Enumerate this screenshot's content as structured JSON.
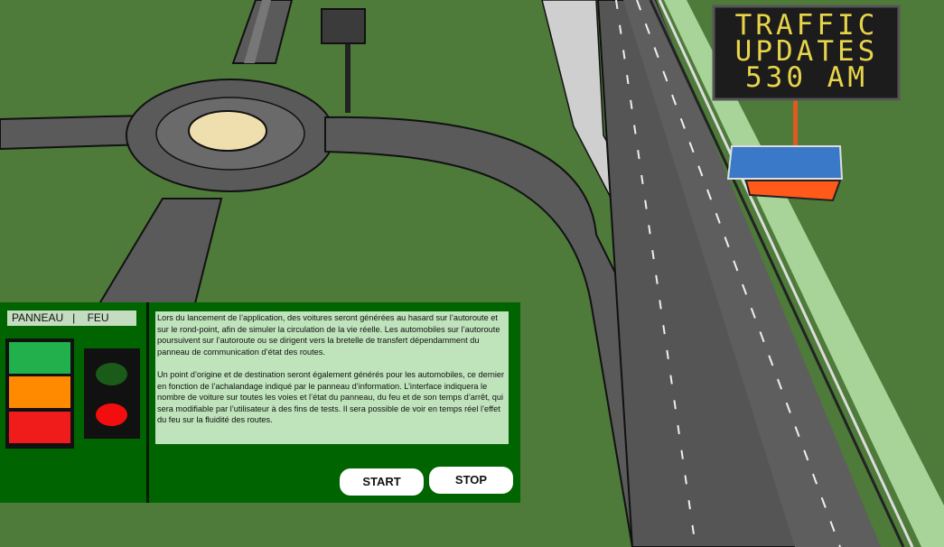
{
  "scene": {
    "traffic_sign": {
      "lines": [
        "TRAFFIC",
        "UPDATES",
        "530 AM"
      ],
      "text_color": "#e8d44a"
    }
  },
  "panel": {
    "header": "PANNEAU   |    FEU",
    "sign_colors": [
      "#21b04c",
      "#ff8a00",
      "#f01c1c"
    ],
    "traffic_light": {
      "green_state": "off",
      "red_state": "on"
    },
    "info": {
      "paragraph1": "Lors du lancement de l’application, des voitures seront générées au hasard sur l’autoroute et sur le rond-point, afin de simuler la circulation de la vie réelle. Les automobiles sur l’autoroute poursuivent sur l’autoroute ou se dirigent vers la bretelle de transfert dépendamment du panneau de communication d’état des routes.",
      "paragraph2": "Un point d’origine et de destination seront également générés pour les automobiles, ce dernier en fonction de l’achalandage indiqué par le panneau d’information. L’interface indiquera le nombre de voiture sur toutes les voies et l’état du panneau, du feu et de son temps d’arrêt, qui sera modifiable par l’utilisateur à des fins de tests. Il sera possible de voir en temps réel l’effet du feu sur la fluidité des routes."
    },
    "buttons": {
      "start": "START",
      "stop": "STOP"
    }
  },
  "colors": {
    "panel_bg": "#006400",
    "grass": "#4e7a3a",
    "road": "#5a5a5a"
  }
}
